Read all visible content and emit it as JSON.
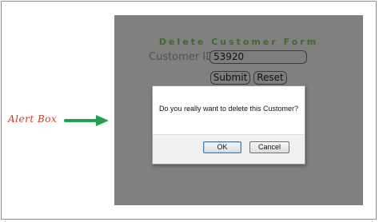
{
  "annotation": {
    "label": "Alert Box",
    "color": "#d23a2a",
    "arrow_color": "#22a04b"
  },
  "form": {
    "title": "Delete Customer Form",
    "customer_id_label": "Customer ID",
    "customer_id_value": "53920",
    "submit_label": "Submit",
    "reset_label": "Reset"
  },
  "dialog": {
    "message": "Do you really want to delete this Customer?",
    "ok_label": "OK",
    "cancel_label": "Cancel"
  },
  "colors": {
    "overlay": "#808080",
    "title_green": "#3e6a2a"
  }
}
